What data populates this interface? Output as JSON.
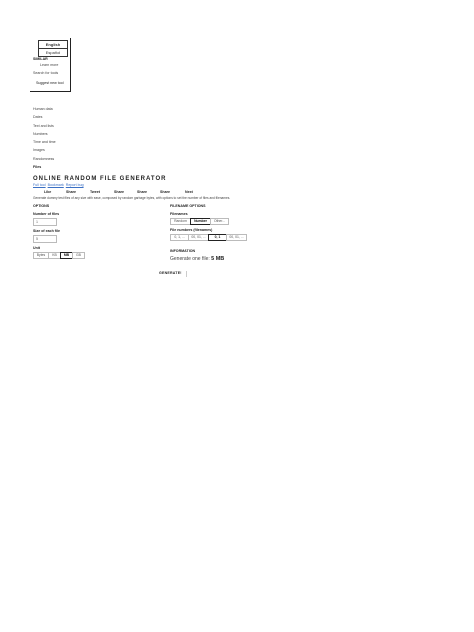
{
  "language": {
    "options": [
      "English",
      "Español"
    ]
  },
  "menu": {
    "heading": "SIMILAR ",
    "login": "Learn more",
    "search_placeholder": "Search for tools",
    "suggest_button": "Suggest new tool"
  },
  "sidebar": {
    "items": [
      "Human data",
      "Dates",
      "Text and lists",
      "Numbers",
      "Time and time",
      "Images",
      "Randomness",
      "Files"
    ]
  },
  "page": {
    "title": "ONLINE RANDOM FILE GENERATOR",
    "breadcrumbs": [
      "Full tool",
      "Bookmark",
      "Report bug"
    ],
    "description": "Generate dummy test files of any size with ease, composed by random garbage bytes, with options to set the number of files and filenames."
  },
  "tabs": [
    "Like",
    "Share",
    "Tweet",
    "Share",
    "Share",
    "Share",
    "Next"
  ],
  "options": {
    "heading": "OPTIONS",
    "num_files_label": "Number of files",
    "num_files_value": "1",
    "size_label": "Size of each file",
    "size_value": "5",
    "unit_label": "Unit",
    "units": [
      "Bytes",
      "KB",
      "MB",
      "GB"
    ],
    "selected_unit": "MB"
  },
  "filename": {
    "heading": "FILENAME OPTIONS",
    "filenames_label": "Filenames",
    "filename_types": [
      "Random",
      "Number",
      "Other..."
    ],
    "selected_type": "Number",
    "format_label": "File numbers (filenames)",
    "formats": [
      "0, 1, ...",
      "00, 01, ...",
      "0, 1",
      "00, 01, ..."
    ],
    "selected_format": "0, 1"
  },
  "information": {
    "heading": "INFORMATION",
    "text": "Generate one file:",
    "size": "5 MB"
  },
  "generate_button": "GENERATE!"
}
